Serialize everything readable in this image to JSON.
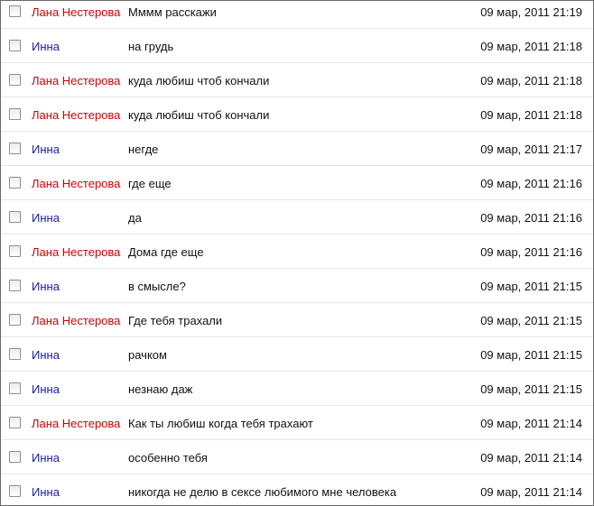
{
  "colors": {
    "sender_lana": "#d40000",
    "sender_inna": "#1a1aa6"
  },
  "messages": [
    {
      "sender": "Лана Нестерова",
      "text": "Мммм расскажи",
      "date": "09 мар, 2011 21:19"
    },
    {
      "sender": "Инна",
      "text": "на грудь",
      "date": "09 мар, 2011 21:18"
    },
    {
      "sender": "Лана Нестерова",
      "text": "куда любиш чтоб кончали",
      "date": "09 мар, 2011 21:18"
    },
    {
      "sender": "Лана Нестерова",
      "text": "куда любиш чтоб кончали",
      "date": "09 мар, 2011 21:18"
    },
    {
      "sender": "Инна",
      "text": "негде",
      "date": "09 мар, 2011 21:17"
    },
    {
      "sender": "Лана Нестерова",
      "text": "где еще",
      "date": "09 мар, 2011 21:16"
    },
    {
      "sender": "Инна",
      "text": "да",
      "date": "09 мар, 2011 21:16"
    },
    {
      "sender": "Лана Нестерова",
      "text": "Дома где еще",
      "date": "09 мар, 2011 21:16"
    },
    {
      "sender": "Инна",
      "text": "в смысле?",
      "date": "09 мар, 2011 21:15"
    },
    {
      "sender": "Лана Нестерова",
      "text": "Где тебя трахали",
      "date": "09 мар, 2011 21:15"
    },
    {
      "sender": "Инна",
      "text": "рачком",
      "date": "09 мар, 2011 21:15"
    },
    {
      "sender": "Инна",
      "text": "незнаю даж",
      "date": "09 мар, 2011 21:15"
    },
    {
      "sender": "Лана Нестерова",
      "text": "Как ты любиш когда тебя трахают",
      "date": "09 мар, 2011 21:14"
    },
    {
      "sender": "Инна",
      "text": "особенно тебя",
      "date": "09 мар, 2011 21:14"
    },
    {
      "sender": "Инна",
      "text": "никогда не делю в сексе любимого мне человека",
      "date": "09 мар, 2011 21:14"
    }
  ]
}
